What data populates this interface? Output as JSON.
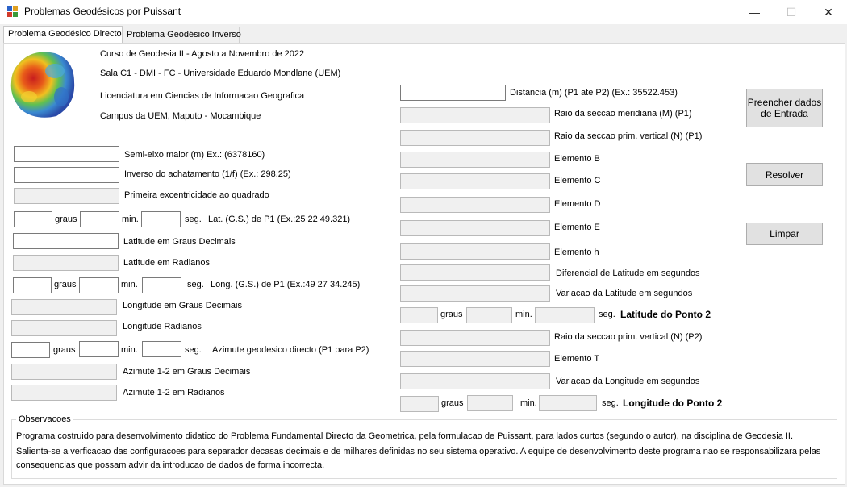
{
  "window": {
    "title": "Problemas Geodésicos por Puissant",
    "icon": "app-window-icon",
    "controls": {
      "minimize": "—",
      "maximize": "☐",
      "close": "✕"
    }
  },
  "tabs": [
    {
      "label": "Problema Geodésico Directo",
      "active": true
    },
    {
      "label": "Problema Geodésico Inverso",
      "active": false
    }
  ],
  "header": {
    "logo": "geoid-globe-image",
    "line1": "Curso de Geodesia II - Agosto a Novembro de 2022",
    "line2": "Sala C1 - DMI - FC - Universidade Eduardo Mondlane (UEM)",
    "line3": "Licenciatura em Ciencias de Informacao Geografica",
    "line4": "Campus da UEM, Maputo - Mocambique"
  },
  "left": {
    "semi_eixo": "Semi-eixo maior (m) Ex.: (6378160)",
    "inverso_achatamento": "Inverso do achatamento (1/f) (Ex.: 298.25)",
    "excentricidade": "Primeira excentricidade ao quadrado",
    "lat_graus": "graus",
    "lat_min": "min.",
    "lat_seg": "seg.",
    "lat_label": "Lat. (G.S.) de P1 (Ex.:25 22 49.321)",
    "lat_decimal": "Latitude em Graus Decimais",
    "lat_rad": "Latitude em Radianos",
    "long_graus": "graus",
    "long_min": "min.",
    "long_seg": "seg.",
    "long_label": "Long. (G.S.) de P1 (Ex.:49 27 34.245)",
    "long_decimal": "Longitude em Graus Decimais",
    "long_rad": "Longitude Radianos",
    "az_graus": "graus",
    "az_min": "min.",
    "az_seg": "seg.",
    "az_label": "Azimute geodesico directo (P1 para P2)",
    "az_decimal": "Azimute 1-2 em Graus Decimais",
    "az_rad": "Azimute 1-2 em Radianos"
  },
  "right": {
    "distancia": "Distancia (m) (P1 ate P2) (Ex.: 35522.453)",
    "raio_meridiana": "Raio da seccao meridiana (M) (P1)",
    "raio_vertical_p1": "Raio da seccao  prim. vertical (N) (P1)",
    "elemento_b": "Elemento B",
    "elemento_c": "Elemento C",
    "elemento_d": "Elemento D",
    "elemento_e": "Elemento E",
    "elemento_h": "Elemento h",
    "dif_latitude": "Diferencial de Latitude em segundos",
    "var_latitude": "Variacao da Latitude em segundos",
    "lat2_graus": "graus",
    "lat2_min": "min.",
    "lat2_seg": "seg.",
    "lat2_label": "Latitude do Ponto 2",
    "raio_vertical_p2": "Raio da seccao  prim. vertical (N) (P2)",
    "elemento_t": "Elemento T",
    "var_longitude": "Variacao da Longitude em segundos",
    "long2_graus": "graus",
    "long2_min": "min.",
    "long2_seg": "seg.",
    "long2_label": "Longitude do Ponto 2"
  },
  "buttons": {
    "preencher_line1": "Preencher dados",
    "preencher_line2": "de  Entrada",
    "resolver": "Resolver",
    "limpar": "Limpar"
  },
  "observacoes": {
    "title": "Observacoes",
    "line1": "Programa costruido para desenvolvimento didatico do Problema Fundamental Directo da Geometrica, pela formulacao de Puissant, para lados curtos (segundo o autor), na disciplina de Geodesia II.",
    "line2": "Salienta-se a verficacao das configuracoes para separador decasas decimais e de milhares definidas no seu sistema operativo. A equipe de desenvolvimento deste programa nao se responsabilizara pelas",
    "line3": "consequencias que possam advir da introducao de dados de forma incorrecta."
  }
}
